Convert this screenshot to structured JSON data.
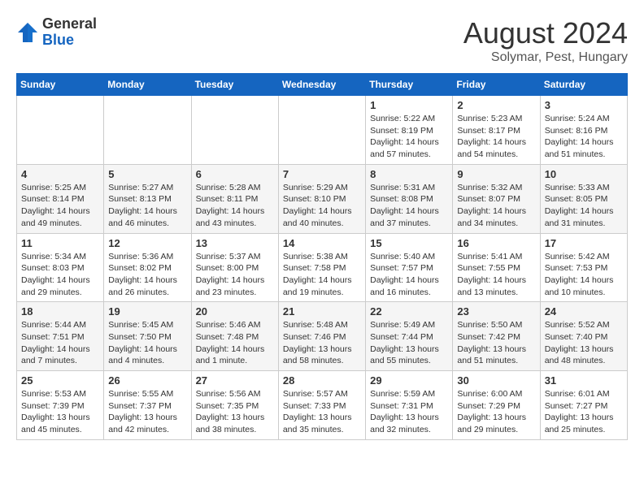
{
  "header": {
    "logo_general": "General",
    "logo_blue": "Blue",
    "month_title": "August 2024",
    "location": "Solymar, Pest, Hungary"
  },
  "weekdays": [
    "Sunday",
    "Monday",
    "Tuesday",
    "Wednesday",
    "Thursday",
    "Friday",
    "Saturday"
  ],
  "weeks": [
    [
      {
        "day": "",
        "info": ""
      },
      {
        "day": "",
        "info": ""
      },
      {
        "day": "",
        "info": ""
      },
      {
        "day": "",
        "info": ""
      },
      {
        "day": "1",
        "info": "Sunrise: 5:22 AM\nSunset: 8:19 PM\nDaylight: 14 hours\nand 57 minutes."
      },
      {
        "day": "2",
        "info": "Sunrise: 5:23 AM\nSunset: 8:17 PM\nDaylight: 14 hours\nand 54 minutes."
      },
      {
        "day": "3",
        "info": "Sunrise: 5:24 AM\nSunset: 8:16 PM\nDaylight: 14 hours\nand 51 minutes."
      }
    ],
    [
      {
        "day": "4",
        "info": "Sunrise: 5:25 AM\nSunset: 8:14 PM\nDaylight: 14 hours\nand 49 minutes."
      },
      {
        "day": "5",
        "info": "Sunrise: 5:27 AM\nSunset: 8:13 PM\nDaylight: 14 hours\nand 46 minutes."
      },
      {
        "day": "6",
        "info": "Sunrise: 5:28 AM\nSunset: 8:11 PM\nDaylight: 14 hours\nand 43 minutes."
      },
      {
        "day": "7",
        "info": "Sunrise: 5:29 AM\nSunset: 8:10 PM\nDaylight: 14 hours\nand 40 minutes."
      },
      {
        "day": "8",
        "info": "Sunrise: 5:31 AM\nSunset: 8:08 PM\nDaylight: 14 hours\nand 37 minutes."
      },
      {
        "day": "9",
        "info": "Sunrise: 5:32 AM\nSunset: 8:07 PM\nDaylight: 14 hours\nand 34 minutes."
      },
      {
        "day": "10",
        "info": "Sunrise: 5:33 AM\nSunset: 8:05 PM\nDaylight: 14 hours\nand 31 minutes."
      }
    ],
    [
      {
        "day": "11",
        "info": "Sunrise: 5:34 AM\nSunset: 8:03 PM\nDaylight: 14 hours\nand 29 minutes."
      },
      {
        "day": "12",
        "info": "Sunrise: 5:36 AM\nSunset: 8:02 PM\nDaylight: 14 hours\nand 26 minutes."
      },
      {
        "day": "13",
        "info": "Sunrise: 5:37 AM\nSunset: 8:00 PM\nDaylight: 14 hours\nand 23 minutes."
      },
      {
        "day": "14",
        "info": "Sunrise: 5:38 AM\nSunset: 7:58 PM\nDaylight: 14 hours\nand 19 minutes."
      },
      {
        "day": "15",
        "info": "Sunrise: 5:40 AM\nSunset: 7:57 PM\nDaylight: 14 hours\nand 16 minutes."
      },
      {
        "day": "16",
        "info": "Sunrise: 5:41 AM\nSunset: 7:55 PM\nDaylight: 14 hours\nand 13 minutes."
      },
      {
        "day": "17",
        "info": "Sunrise: 5:42 AM\nSunset: 7:53 PM\nDaylight: 14 hours\nand 10 minutes."
      }
    ],
    [
      {
        "day": "18",
        "info": "Sunrise: 5:44 AM\nSunset: 7:51 PM\nDaylight: 14 hours\nand 7 minutes."
      },
      {
        "day": "19",
        "info": "Sunrise: 5:45 AM\nSunset: 7:50 PM\nDaylight: 14 hours\nand 4 minutes."
      },
      {
        "day": "20",
        "info": "Sunrise: 5:46 AM\nSunset: 7:48 PM\nDaylight: 14 hours\nand 1 minute."
      },
      {
        "day": "21",
        "info": "Sunrise: 5:48 AM\nSunset: 7:46 PM\nDaylight: 13 hours\nand 58 minutes."
      },
      {
        "day": "22",
        "info": "Sunrise: 5:49 AM\nSunset: 7:44 PM\nDaylight: 13 hours\nand 55 minutes."
      },
      {
        "day": "23",
        "info": "Sunrise: 5:50 AM\nSunset: 7:42 PM\nDaylight: 13 hours\nand 51 minutes."
      },
      {
        "day": "24",
        "info": "Sunrise: 5:52 AM\nSunset: 7:40 PM\nDaylight: 13 hours\nand 48 minutes."
      }
    ],
    [
      {
        "day": "25",
        "info": "Sunrise: 5:53 AM\nSunset: 7:39 PM\nDaylight: 13 hours\nand 45 minutes."
      },
      {
        "day": "26",
        "info": "Sunrise: 5:55 AM\nSunset: 7:37 PM\nDaylight: 13 hours\nand 42 minutes."
      },
      {
        "day": "27",
        "info": "Sunrise: 5:56 AM\nSunset: 7:35 PM\nDaylight: 13 hours\nand 38 minutes."
      },
      {
        "day": "28",
        "info": "Sunrise: 5:57 AM\nSunset: 7:33 PM\nDaylight: 13 hours\nand 35 minutes."
      },
      {
        "day": "29",
        "info": "Sunrise: 5:59 AM\nSunset: 7:31 PM\nDaylight: 13 hours\nand 32 minutes."
      },
      {
        "day": "30",
        "info": "Sunrise: 6:00 AM\nSunset: 7:29 PM\nDaylight: 13 hours\nand 29 minutes."
      },
      {
        "day": "31",
        "info": "Sunrise: 6:01 AM\nSunset: 7:27 PM\nDaylight: 13 hours\nand 25 minutes."
      }
    ]
  ]
}
